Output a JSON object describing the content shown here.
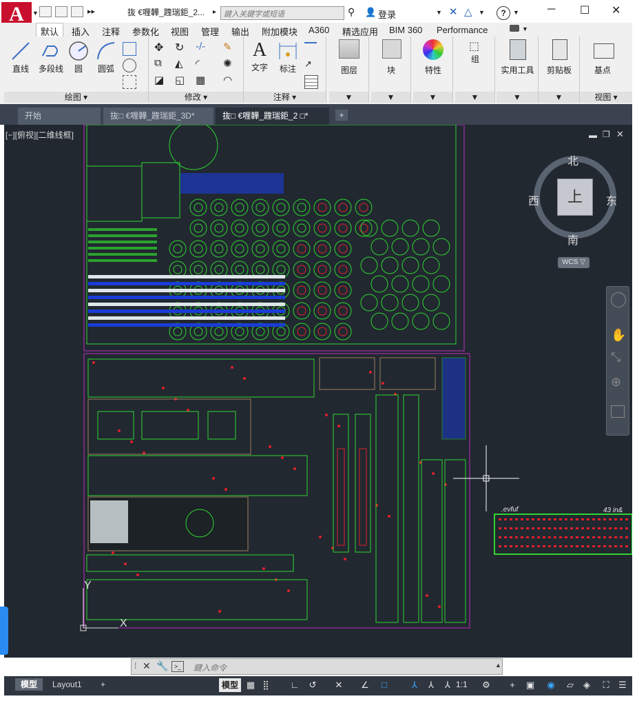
{
  "window": {
    "title": "抜    €喱韡_韙瑞鉅_2...",
    "minimize": "─",
    "maximize": "☐",
    "close": "✕"
  },
  "app": {
    "logo": "A"
  },
  "search": {
    "placeholder": "鍵入关鍵字或短语"
  },
  "account": {
    "login": "登录"
  },
  "ribbon_tabs": [
    "默认",
    "插入",
    "注释",
    "参数化",
    "视图",
    "管理",
    "输出",
    "附加模块",
    "A360",
    "精选应用",
    "BIM 360",
    "Performance"
  ],
  "active_ribbon_tab": "默认",
  "panels": {
    "draw": {
      "title": "绘图 ▾",
      "line": "直线",
      "polyline": "多段线",
      "circle": "圆",
      "arc": "圆弧"
    },
    "modify": {
      "title": "修改 ▾"
    },
    "annotation": {
      "title": "注释 ▾",
      "text": "文字",
      "dimension": "标注"
    },
    "layers": {
      "label": "图层"
    },
    "block": {
      "label": "块"
    },
    "properties": {
      "label": "特性"
    },
    "groups": {
      "label": "组"
    },
    "utilities": {
      "label": "实用工具"
    },
    "clipboard": {
      "label": "剪贴板"
    },
    "view": {
      "base": "基点",
      "title": "视图 ▾"
    }
  },
  "doc_tabs": [
    "开始",
    "抜□ €喱韡_韙瑞鉅_3D*",
    "抜□ €喱韡_韙瑞鉅_2 □*"
  ],
  "viewport": {
    "label": "[−][俯视][二维线框]"
  },
  "viewcube": {
    "north": "北",
    "south": "南",
    "east": "东",
    "west": "西",
    "top": "上",
    "wcs": "WCS ▽"
  },
  "drawing_text": {
    "left_label": ".evfuf",
    "right_label": "43 in&"
  },
  "command": {
    "placeholder": "鍵入命令"
  },
  "layout_tabs": [
    "模型",
    "Layout1"
  ],
  "active_layout_tab": "模型",
  "status": {
    "model": "模型",
    "scale": "1:1"
  },
  "colors": {
    "background": "#212830",
    "green": "#2fd62f",
    "blue": "#1a3cd8",
    "red": "#e0202a",
    "magenta": "#c02ac0",
    "accent": "#c8102e"
  }
}
